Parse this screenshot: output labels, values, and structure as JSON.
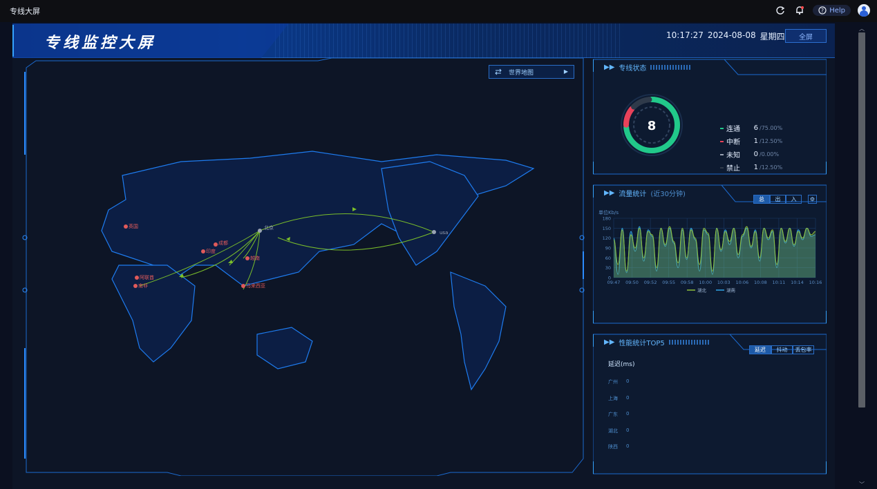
{
  "app": {
    "title": "专线大屏",
    "help_label": "Help"
  },
  "header": {
    "name": "专线监控大屏",
    "time": "10:17:27",
    "date": "2024-08-08",
    "weekday": "星期四",
    "fullscreen_label": "全屏"
  },
  "map": {
    "selector_label": "世界地图",
    "points": [
      {
        "label": "usa"
      },
      {
        "label": "北京"
      },
      {
        "label": "成都"
      },
      {
        "label": "印度"
      },
      {
        "label": "越南"
      },
      {
        "label": "马来西亚"
      },
      {
        "label": "英国"
      },
      {
        "label": "阿联酋"
      },
      {
        "label": "南非"
      }
    ]
  },
  "status_panel": {
    "title": "专线状态",
    "total": "8",
    "items": [
      {
        "label": "连通",
        "count": "6",
        "pct": "/75.00%",
        "color": "#21c98a"
      },
      {
        "label": "中断",
        "count": "1",
        "pct": "/12.50%",
        "color": "#e8425a"
      },
      {
        "label": "未知",
        "count": "0",
        "pct": "/0.00%",
        "color": "#9aa3b3"
      },
      {
        "label": "禁止",
        "count": "1",
        "pct": "/12.50%",
        "color": "#2f3a4a"
      }
    ]
  },
  "traffic_panel": {
    "title": "流量统计",
    "subtitle": "(近30分钟)",
    "tabs": [
      "总",
      "出",
      "入"
    ],
    "active_tab": 0,
    "unit": "单位Kb/s"
  },
  "chart_data": {
    "type": "area",
    "ylabel": "单位Kb/s",
    "ylim": [
      0,
      180
    ],
    "yticks": [
      0,
      30,
      60,
      90,
      120,
      150,
      180
    ],
    "x": [
      "09:47",
      "09:50",
      "09:52",
      "09:55",
      "09:58",
      "10:00",
      "10:03",
      "10:06",
      "10:08",
      "10:11",
      "10:14",
      "10:16"
    ],
    "series": [
      {
        "name": "湖北",
        "color": "#8fbf3a",
        "values": [
          115,
          40,
          145,
          20,
          130,
          90,
          150,
          60,
          140,
          130,
          30,
          150,
          100,
          155,
          110,
          45,
          150,
          60,
          145,
          120,
          40,
          150,
          135,
          20,
          150,
          85,
          140,
          110,
          150,
          70,
          130,
          155,
          95,
          140,
          60,
          150,
          120,
          145,
          40,
          150,
          110,
          150,
          100,
          140,
          120,
          150,
          130,
          140
        ]
      },
      {
        "name": "湖南",
        "color": "#2fa4e7",
        "values": [
          120,
          10,
          150,
          15,
          140,
          80,
          155,
          50,
          145,
          125,
          20,
          150,
          95,
          150,
          105,
          30,
          145,
          55,
          150,
          115,
          20,
          145,
          130,
          10,
          150,
          80,
          145,
          100,
          150,
          60,
          125,
          150,
          90,
          145,
          50,
          150,
          115,
          140,
          30,
          150,
          105,
          150,
          95,
          145,
          115,
          150,
          125,
          130
        ]
      }
    ]
  },
  "perf_panel": {
    "title": "性能统计TOP5",
    "tabs": [
      "延迟",
      "抖动",
      "丢包率"
    ],
    "active_tab": 0,
    "metric_label": "延迟(ms)",
    "rows": [
      {
        "name": "广州",
        "value": "0"
      },
      {
        "name": "上海",
        "value": "0"
      },
      {
        "name": "广东",
        "value": "0"
      },
      {
        "name": "湖北",
        "value": "0"
      },
      {
        "name": "陕西",
        "value": "0"
      }
    ]
  }
}
